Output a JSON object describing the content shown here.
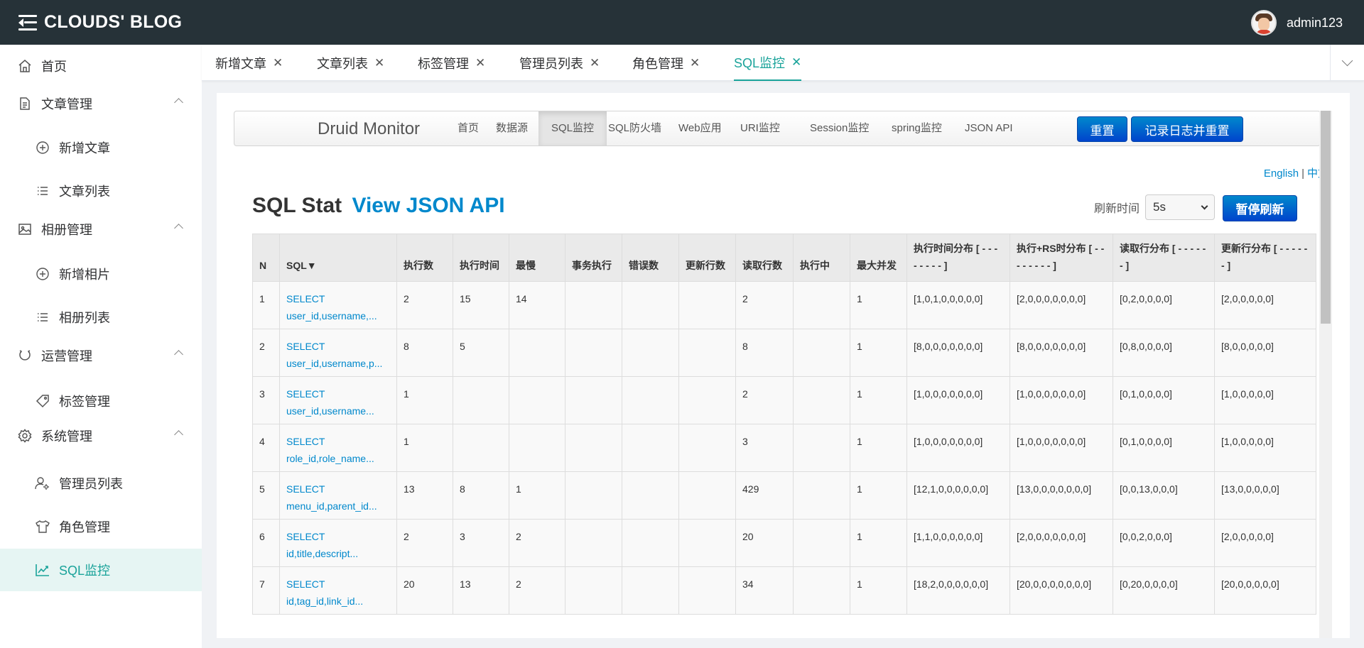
{
  "header": {
    "brand": "CLOUDS' BLOG",
    "username": "admin123"
  },
  "sidebar": {
    "items": [
      {
        "label": "首页",
        "icon": "home-icon",
        "type": "link"
      },
      {
        "label": "文章管理",
        "icon": "document-icon",
        "type": "group"
      },
      {
        "label": "新增文章",
        "icon": "plus-circle-icon",
        "type": "sub"
      },
      {
        "label": "文章列表",
        "icon": "list-icon",
        "type": "sub"
      },
      {
        "label": "相册管理",
        "icon": "picture-icon",
        "type": "group"
      },
      {
        "label": "新增相片",
        "icon": "plus-circle-icon",
        "type": "sub"
      },
      {
        "label": "相册列表",
        "icon": "list-icon",
        "type": "sub"
      },
      {
        "label": "运营管理",
        "icon": "operation-icon",
        "type": "group"
      },
      {
        "label": "标签管理",
        "icon": "tag-icon",
        "type": "sub"
      },
      {
        "label": "系统管理",
        "icon": "gear-icon",
        "type": "group"
      },
      {
        "label": "管理员列表",
        "icon": "user-gear-icon",
        "type": "sub"
      },
      {
        "label": "角色管理",
        "icon": "shirt-icon",
        "type": "sub"
      },
      {
        "label": "SQL监控",
        "icon": "chart-line-icon",
        "type": "sub",
        "active": true
      }
    ]
  },
  "tabs": [
    {
      "label": "新增文章"
    },
    {
      "label": "文章列表"
    },
    {
      "label": "标签管理"
    },
    {
      "label": "管理员列表"
    },
    {
      "label": "角色管理"
    },
    {
      "label": "SQL监控",
      "active": true
    }
  ],
  "druid": {
    "brand": "Druid Monitor",
    "nav": [
      "首页",
      "数据源",
      "SQL监控",
      "SQL防火墙",
      "Web应用",
      "URI监控",
      "Session监控",
      "spring监控",
      "JSON API"
    ],
    "active_nav": "SQL监控",
    "reset_label": "重置",
    "log_reset_label": "记录日志并重置",
    "lang": {
      "english": "English",
      "sep": "|",
      "chinese": "中文"
    },
    "stat_title": "SQL Stat",
    "stat_link": "View JSON API",
    "refresh_label": "刷新时间",
    "refresh_value": "5s",
    "pause_label": "暂停刷新"
  },
  "table": {
    "headers": [
      "N",
      "SQL▼",
      "执行数",
      "执行时间",
      "最慢",
      "事务执行",
      "错误数",
      "更新行数",
      "读取行数",
      "执行中",
      "最大并发",
      "执行时间分布 [ - - - - - - - - ]",
      "执行+RS时分布 [ - - - - - - - - ]",
      "读取行分布 [ - - - - - - ]",
      "更新行分布 [ - - - - - - ]"
    ],
    "rows": [
      {
        "n": "1",
        "sql1": "SELECT",
        "sql2": "user_id,username,...",
        "exec": "2",
        "time": "15",
        "slow": "14",
        "txn": "",
        "err": "",
        "upd": "",
        "read": "2",
        "running": "",
        "maxc": "1",
        "tdist": "[1,0,1,0,0,0,0,0]",
        "rsdist": "[2,0,0,0,0,0,0,0]",
        "rdist": "[0,2,0,0,0,0]",
        "udist": "[2,0,0,0,0,0]"
      },
      {
        "n": "2",
        "sql1": "SELECT",
        "sql2": "user_id,username,p...",
        "exec": "8",
        "time": "5",
        "slow": "",
        "txn": "",
        "err": "",
        "upd": "",
        "read": "8",
        "running": "",
        "maxc": "1",
        "tdist": "[8,0,0,0,0,0,0,0]",
        "rsdist": "[8,0,0,0,0,0,0,0]",
        "rdist": "[0,8,0,0,0,0]",
        "udist": "[8,0,0,0,0,0]"
      },
      {
        "n": "3",
        "sql1": "SELECT",
        "sql2": "user_id,username...",
        "exec": "1",
        "time": "",
        "slow": "",
        "txn": "",
        "err": "",
        "upd": "",
        "read": "2",
        "running": "",
        "maxc": "1",
        "tdist": "[1,0,0,0,0,0,0,0]",
        "rsdist": "[1,0,0,0,0,0,0,0]",
        "rdist": "[0,1,0,0,0,0]",
        "udist": "[1,0,0,0,0,0]"
      },
      {
        "n": "4",
        "sql1": "SELECT",
        "sql2": "role_id,role_name...",
        "exec": "1",
        "time": "",
        "slow": "",
        "txn": "",
        "err": "",
        "upd": "",
        "read": "3",
        "running": "",
        "maxc": "1",
        "tdist": "[1,0,0,0,0,0,0,0]",
        "rsdist": "[1,0,0,0,0,0,0,0]",
        "rdist": "[0,1,0,0,0,0]",
        "udist": "[1,0,0,0,0,0]"
      },
      {
        "n": "5",
        "sql1": "SELECT",
        "sql2": "menu_id,parent_id...",
        "exec": "13",
        "time": "8",
        "slow": "1",
        "txn": "",
        "err": "",
        "upd": "",
        "read": "429",
        "running": "",
        "maxc": "1",
        "tdist": "[12,1,0,0,0,0,0,0]",
        "rsdist": "[13,0,0,0,0,0,0,0]",
        "rdist": "[0,0,13,0,0,0]",
        "udist": "[13,0,0,0,0,0]"
      },
      {
        "n": "6",
        "sql1": "SELECT",
        "sql2": "id,title,descript...",
        "exec": "2",
        "time": "3",
        "slow": "2",
        "txn": "",
        "err": "",
        "upd": "",
        "read": "20",
        "running": "",
        "maxc": "1",
        "tdist": "[1,1,0,0,0,0,0,0]",
        "rsdist": "[2,0,0,0,0,0,0,0]",
        "rdist": "[0,0,2,0,0,0]",
        "udist": "[2,0,0,0,0,0]"
      },
      {
        "n": "7",
        "sql1": "SELECT",
        "sql2": "id,tag_id,link_id...",
        "exec": "20",
        "time": "13",
        "slow": "2",
        "txn": "",
        "err": "",
        "upd": "",
        "read": "34",
        "running": "",
        "maxc": "1",
        "tdist": "[18,2,0,0,0,0,0,0]",
        "rsdist": "[20,0,0,0,0,0,0,0]",
        "rdist": "[0,20,0,0,0,0]",
        "udist": "[20,0,0,0,0,0]"
      }
    ]
  }
}
